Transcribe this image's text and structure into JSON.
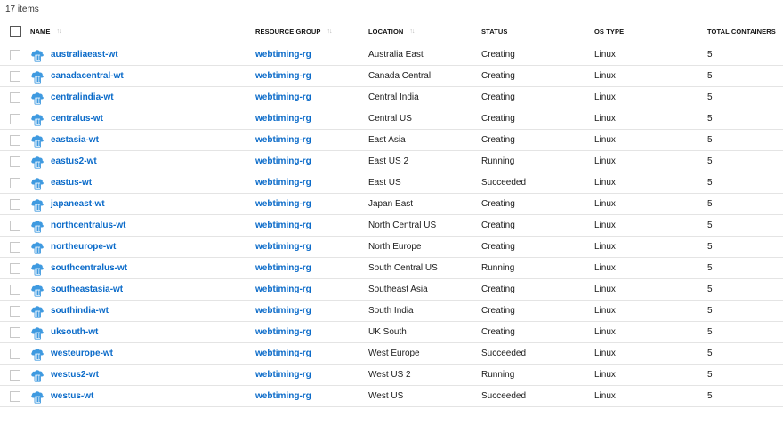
{
  "item_count": "17 items",
  "columns": {
    "name": "NAME",
    "resource_group": "RESOURCE GROUP",
    "location": "LOCATION",
    "status": "STATUS",
    "os_type": "OS TYPE",
    "total_containers": "TOTAL CONTAINERS"
  },
  "sort_indicator": "↑↓",
  "rows": [
    {
      "name": "australiaeast-wt",
      "resource_group": "webtiming-rg",
      "location": "Australia East",
      "status": "Creating",
      "os_type": "Linux",
      "total_containers": "5"
    },
    {
      "name": "canadacentral-wt",
      "resource_group": "webtiming-rg",
      "location": "Canada Central",
      "status": "Creating",
      "os_type": "Linux",
      "total_containers": "5"
    },
    {
      "name": "centralindia-wt",
      "resource_group": "webtiming-rg",
      "location": "Central India",
      "status": "Creating",
      "os_type": "Linux",
      "total_containers": "5"
    },
    {
      "name": "centralus-wt",
      "resource_group": "webtiming-rg",
      "location": "Central US",
      "status": "Creating",
      "os_type": "Linux",
      "total_containers": "5"
    },
    {
      "name": "eastasia-wt",
      "resource_group": "webtiming-rg",
      "location": "East Asia",
      "status": "Creating",
      "os_type": "Linux",
      "total_containers": "5"
    },
    {
      "name": "eastus2-wt",
      "resource_group": "webtiming-rg",
      "location": "East US 2",
      "status": "Running",
      "os_type": "Linux",
      "total_containers": "5"
    },
    {
      "name": "eastus-wt",
      "resource_group": "webtiming-rg",
      "location": "East US",
      "status": "Succeeded",
      "os_type": "Linux",
      "total_containers": "5"
    },
    {
      "name": "japaneast-wt",
      "resource_group": "webtiming-rg",
      "location": "Japan East",
      "status": "Creating",
      "os_type": "Linux",
      "total_containers": "5"
    },
    {
      "name": "northcentralus-wt",
      "resource_group": "webtiming-rg",
      "location": "North Central US",
      "status": "Creating",
      "os_type": "Linux",
      "total_containers": "5"
    },
    {
      "name": "northeurope-wt",
      "resource_group": "webtiming-rg",
      "location": "North Europe",
      "status": "Creating",
      "os_type": "Linux",
      "total_containers": "5"
    },
    {
      "name": "southcentralus-wt",
      "resource_group": "webtiming-rg",
      "location": "South Central US",
      "status": "Running",
      "os_type": "Linux",
      "total_containers": "5"
    },
    {
      "name": "southeastasia-wt",
      "resource_group": "webtiming-rg",
      "location": "Southeast Asia",
      "status": "Creating",
      "os_type": "Linux",
      "total_containers": "5"
    },
    {
      "name": "southindia-wt",
      "resource_group": "webtiming-rg",
      "location": "South India",
      "status": "Creating",
      "os_type": "Linux",
      "total_containers": "5"
    },
    {
      "name": "uksouth-wt",
      "resource_group": "webtiming-rg",
      "location": "UK South",
      "status": "Creating",
      "os_type": "Linux",
      "total_containers": "5"
    },
    {
      "name": "westeurope-wt",
      "resource_group": "webtiming-rg",
      "location": "West Europe",
      "status": "Succeeded",
      "os_type": "Linux",
      "total_containers": "5"
    },
    {
      "name": "westus2-wt",
      "resource_group": "webtiming-rg",
      "location": "West US 2",
      "status": "Running",
      "os_type": "Linux",
      "total_containers": "5"
    },
    {
      "name": "westus-wt",
      "resource_group": "webtiming-rg",
      "location": "West US",
      "status": "Succeeded",
      "os_type": "Linux",
      "total_containers": "5"
    }
  ],
  "icons": {
    "row_icon": "container-instance-icon"
  },
  "colors": {
    "link": "#0b6bc9",
    "icon_blue": "#3f9ae0"
  }
}
